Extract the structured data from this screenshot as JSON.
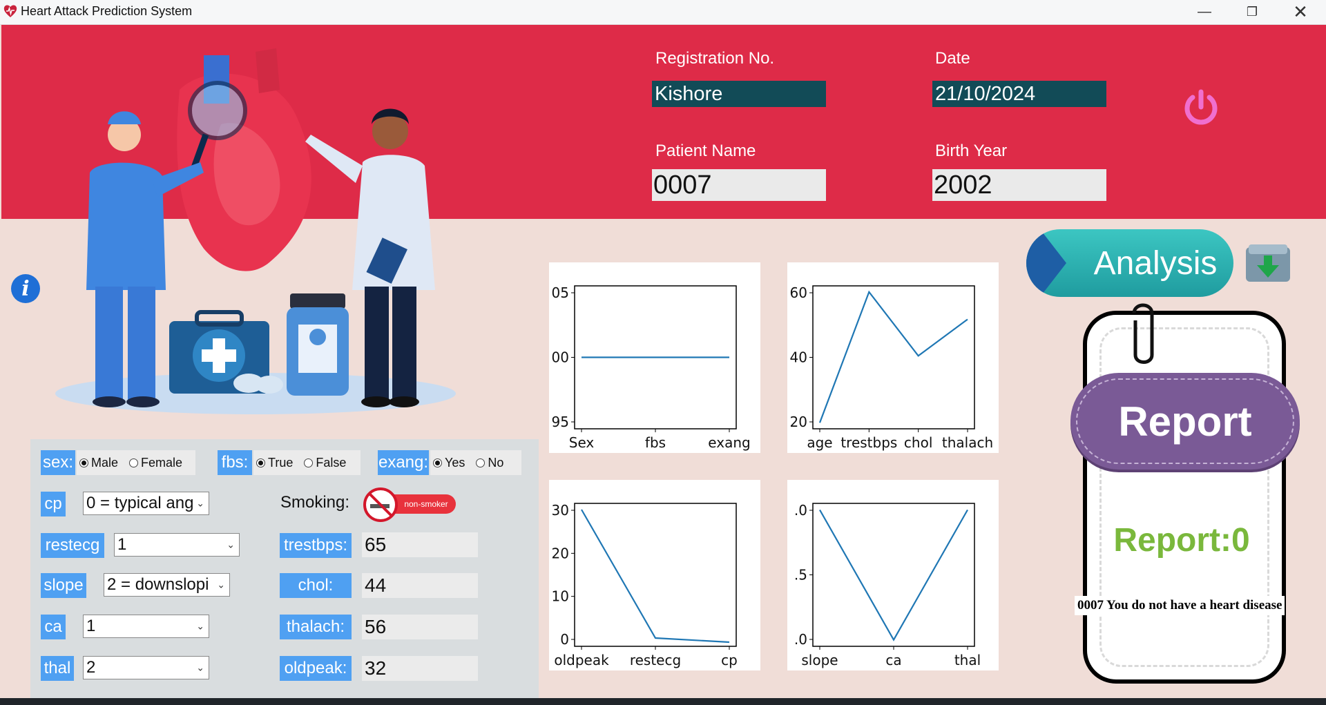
{
  "window": {
    "title": "Heart Attack Prediction System",
    "controls": [
      "minimize-icon",
      "restore-icon",
      "close-icon"
    ]
  },
  "header": {
    "registration_label": "Registration No.",
    "registration_value": "Kishore",
    "date_label": "Date",
    "date_value": "21/10/2024",
    "patient_name_label": "Patient Name",
    "patient_name_value": "0007",
    "birth_year_label": "Birth Year",
    "birth_year_value": "2002",
    "power_icon": "power-icon"
  },
  "form": {
    "sex": {
      "label": "sex:",
      "options": [
        "Male",
        "Female"
      ],
      "selected": "Male"
    },
    "fbs": {
      "label": "fbs:",
      "options": [
        "True",
        "False"
      ],
      "selected": "True"
    },
    "exang": {
      "label": "exang:",
      "options": [
        "Yes",
        "No"
      ],
      "selected": "Yes"
    },
    "cp": {
      "label": "cp",
      "value": "0 = typical ang"
    },
    "restecg": {
      "label": "restecg",
      "value": "1"
    },
    "slope": {
      "label": "slope",
      "value": "2 = downslopi"
    },
    "ca": {
      "label": "ca",
      "value": "1"
    },
    "thal": {
      "label": "thal",
      "value": "2"
    },
    "smoking": {
      "label": "Smoking:",
      "badge": "non-smoker"
    },
    "trestbps": {
      "label": "trestbps:",
      "value": "65"
    },
    "chol": {
      "label": "chol:",
      "value": "44"
    },
    "thalach": {
      "label": "thalach:",
      "value": "56"
    },
    "oldpeak": {
      "label": "oldpeak:",
      "value": "32"
    }
  },
  "buttons": {
    "analysis": "Analysis",
    "download_icon": "download-icon",
    "info_icon": "info-icon"
  },
  "report": {
    "title": "Report",
    "result": "Report:0",
    "message": "0007 You do not have a heart disease"
  },
  "colors": {
    "header_red": "#de2b48",
    "background": "#f0ddd7",
    "label_blue": "#4fa0f2",
    "dark_teal": "#124b57",
    "analysis_teal": "#22a6a8",
    "report_purple": "#7a5a96",
    "report_green": "#7ab83c",
    "line_blue": "#1f77b4"
  },
  "chart_data": [
    {
      "type": "line",
      "categories": [
        "Sex",
        "fbs",
        "exang"
      ],
      "values": [
        1,
        1,
        1
      ],
      "yticks": [
        "05",
        "00",
        "95"
      ],
      "ylim": [
        0.95,
        1.05
      ]
    },
    {
      "type": "line",
      "categories": [
        "age",
        "trestbps",
        "chol",
        "thalach"
      ],
      "values": [
        22,
        65,
        44,
        56
      ],
      "yticks": [
        "60",
        "40",
        "20"
      ],
      "ylim": [
        20,
        67
      ]
    },
    {
      "type": "line",
      "categories": [
        "oldpeak",
        "restecg",
        "cp"
      ],
      "values": [
        32,
        1,
        0
      ],
      "yticks": [
        "30",
        "20",
        "10",
        "0"
      ],
      "ylim": [
        -1,
        33.5
      ]
    },
    {
      "type": "line",
      "categories": [
        "slope",
        "ca",
        "thal"
      ],
      "values": [
        2,
        1,
        2
      ],
      "yticks": [
        ".0",
        ".5",
        ".0"
      ],
      "ylim": [
        0.95,
        2.05
      ]
    }
  ]
}
